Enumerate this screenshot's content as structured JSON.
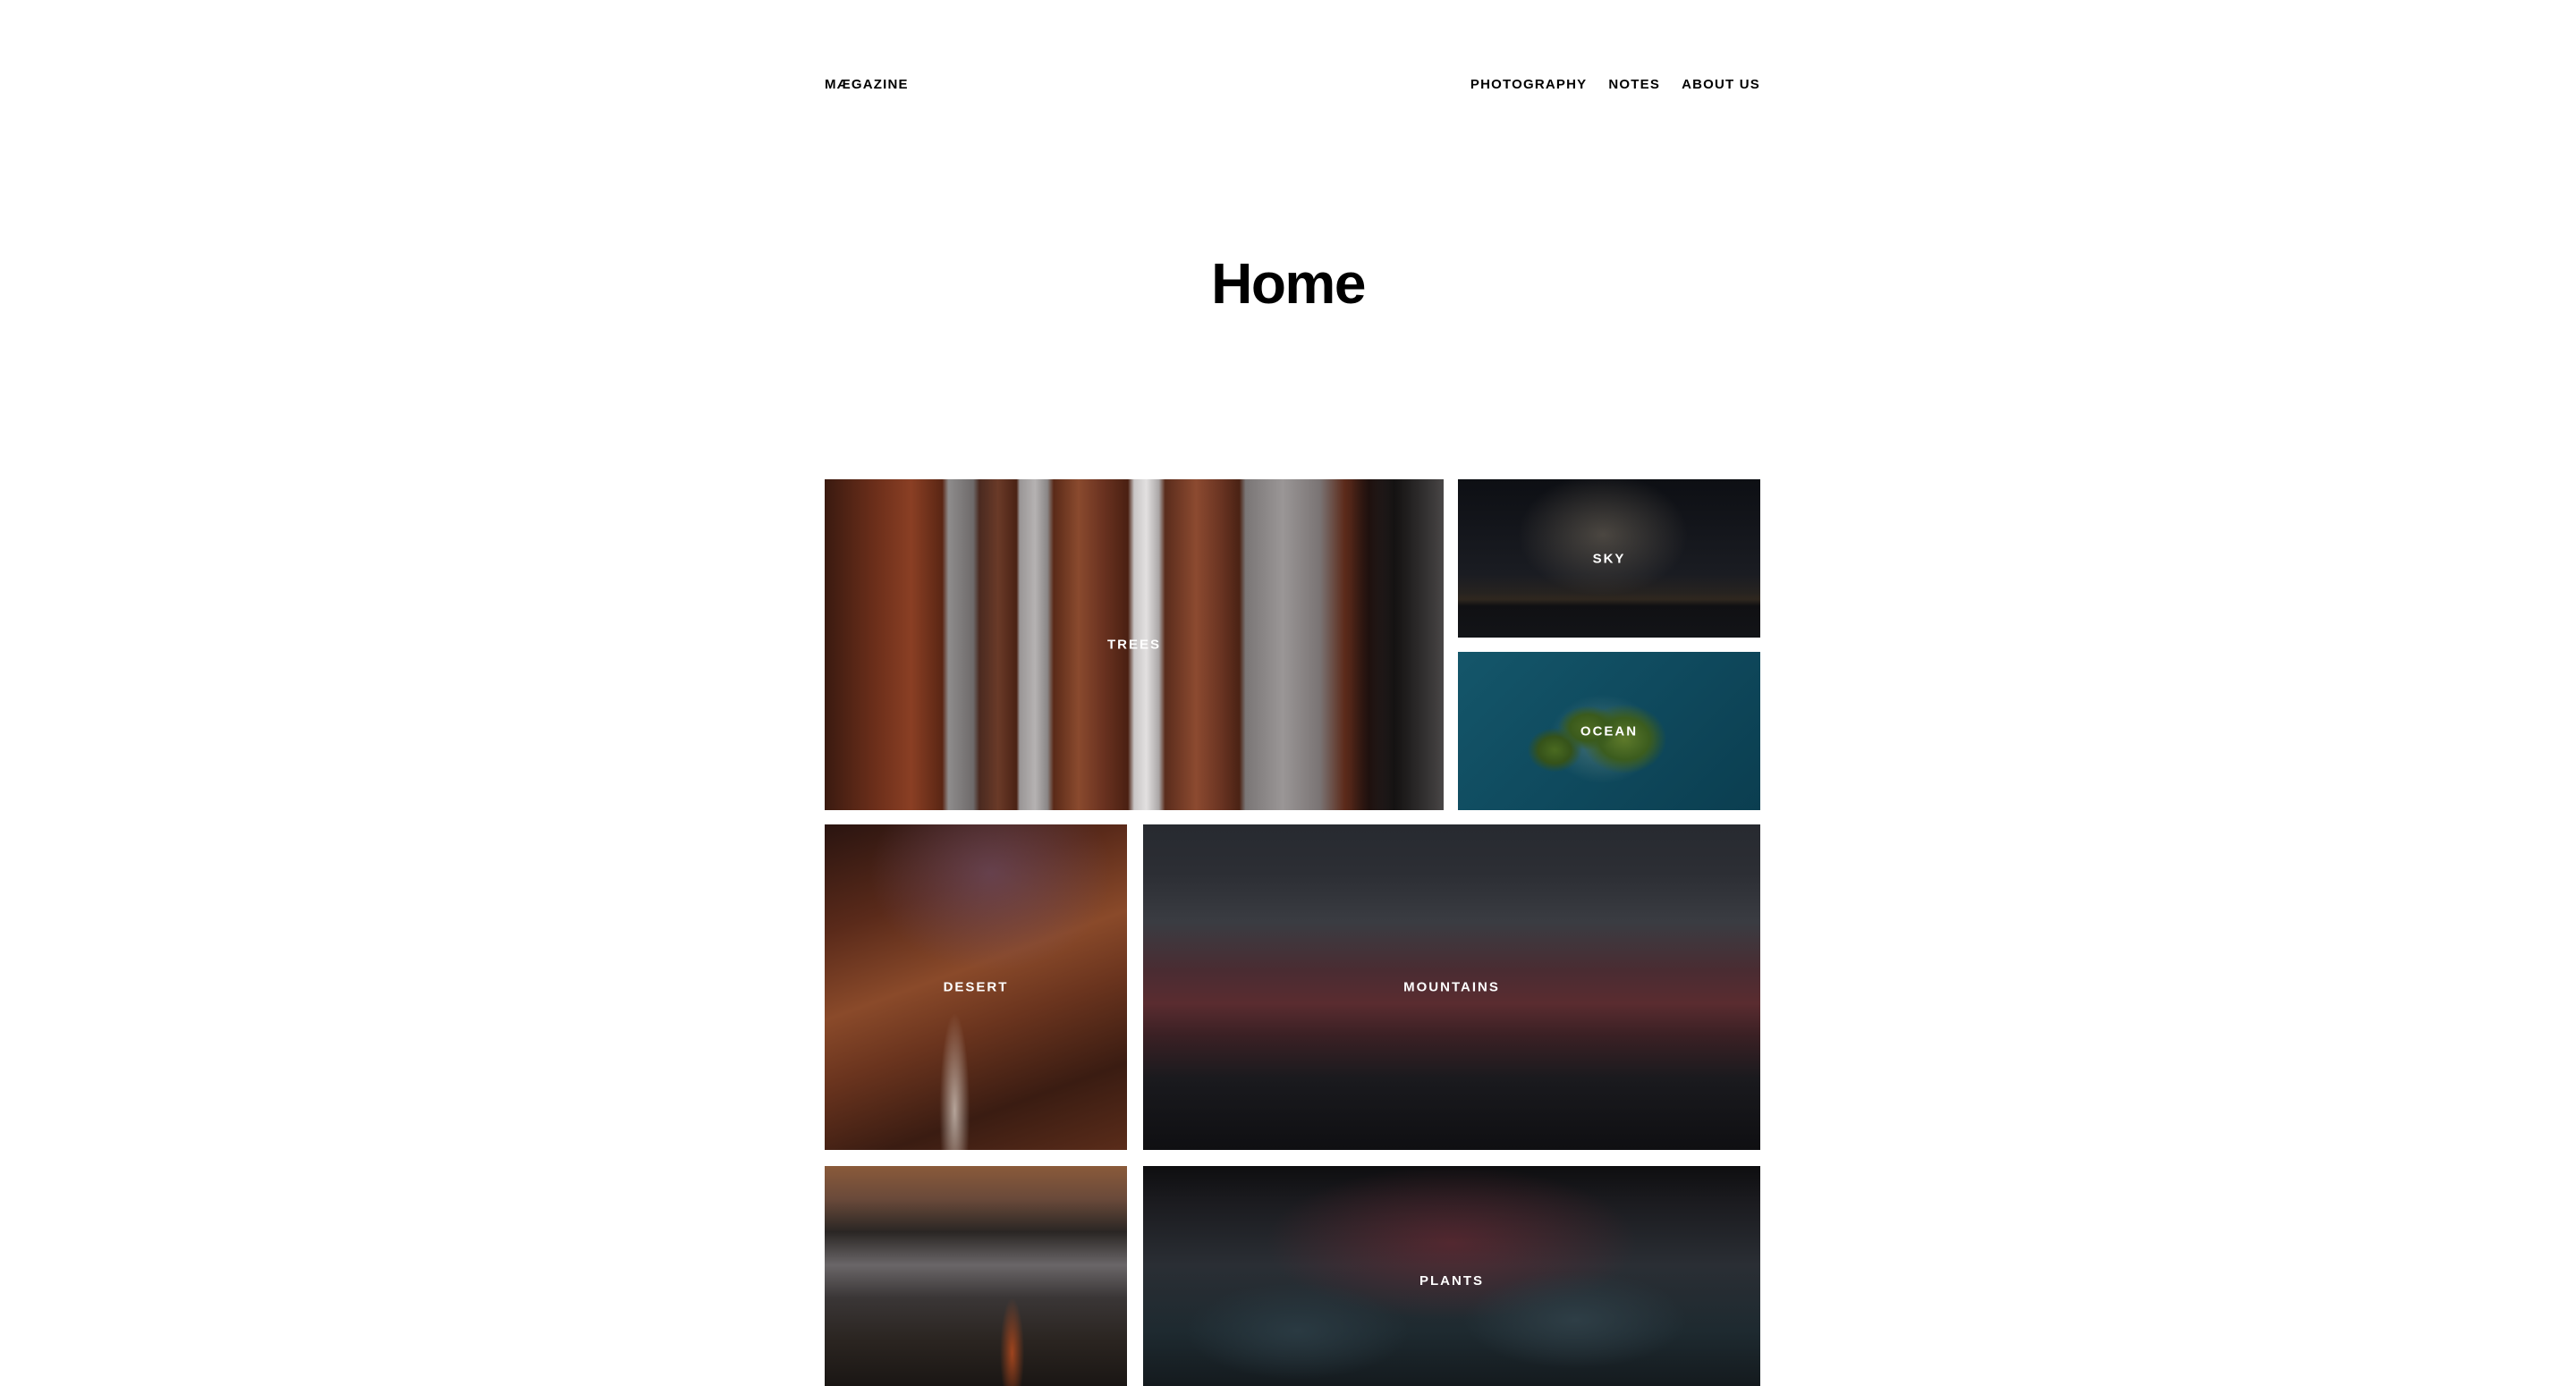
{
  "header": {
    "logo": "MÆGAZINE",
    "nav": [
      {
        "label": "PHOTOGRAPHY"
      },
      {
        "label": "NOTES"
      },
      {
        "label": "ABOUT US"
      }
    ]
  },
  "main": {
    "title": "Home",
    "tiles": [
      {
        "label": "TREES"
      },
      {
        "label": "SKY"
      },
      {
        "label": "OCEAN"
      },
      {
        "label": "DESERT"
      },
      {
        "label": "MOUNTAINS"
      },
      {
        "label": ""
      },
      {
        "label": "PLANTS"
      }
    ]
  }
}
